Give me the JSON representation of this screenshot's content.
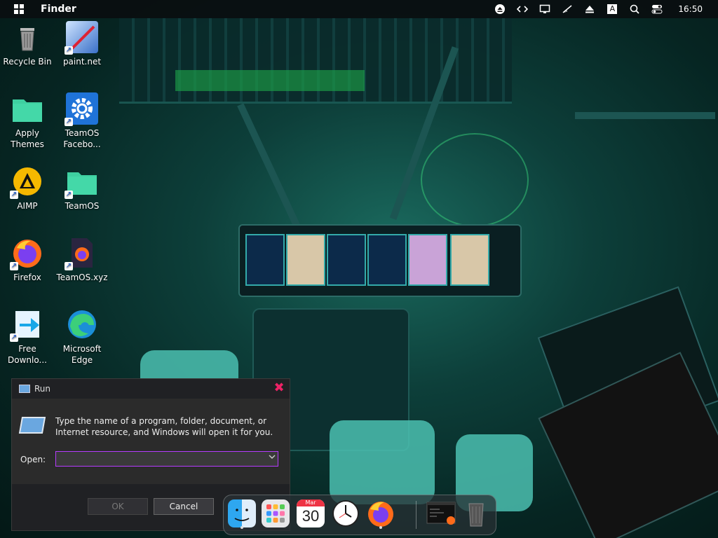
{
  "topbar": {
    "app_name": "Finder",
    "clock": "16:50",
    "tray_icons": [
      "eject-icon",
      "code-icon",
      "monitor-icon",
      "mute-icon",
      "upload-icon",
      "keyboard-layout-icon",
      "search-icon",
      "control-center-icon"
    ],
    "keyboard_label": "A"
  },
  "desktop": {
    "icons": [
      {
        "label": "Recycle Bin",
        "icon": "recycle-bin-icon"
      },
      {
        "label": "paint.net",
        "icon": "paintnet-icon"
      },
      {
        "label": "Apply\nThemes",
        "icon": "folder-icon"
      },
      {
        "label": "TeamOS\nFacebo...",
        "icon": "gear-icon"
      },
      {
        "label": "AIMP",
        "icon": "aimp-icon"
      },
      {
        "label": "TeamOS",
        "icon": "folder-icon"
      },
      {
        "label": "Firefox",
        "icon": "firefox-icon"
      },
      {
        "label": "TeamOS.xyz",
        "icon": "firefox-file-icon"
      },
      {
        "label": "Free\nDownlo...",
        "icon": "free-download-manager-icon"
      },
      {
        "label": "Microsoft\nEdge",
        "icon": "edge-icon"
      }
    ]
  },
  "run_dialog": {
    "title": "Run",
    "description": "Type the name of a program, folder, document, or Internet resource, and Windows will open it for you.",
    "open_label": "Open:",
    "open_value": "",
    "ok_label": "OK",
    "cancel_label": "Cancel"
  },
  "dock": {
    "items": [
      "finder-icon",
      "launchpad-icon",
      "calendar-icon",
      "clock-icon",
      "firefox-icon",
      "terminal-icon",
      "trash-icon"
    ],
    "calendar_month": "Mar",
    "calendar_day": "30"
  },
  "colors": {
    "accent": "#b63cff",
    "close": "#e2336a"
  }
}
